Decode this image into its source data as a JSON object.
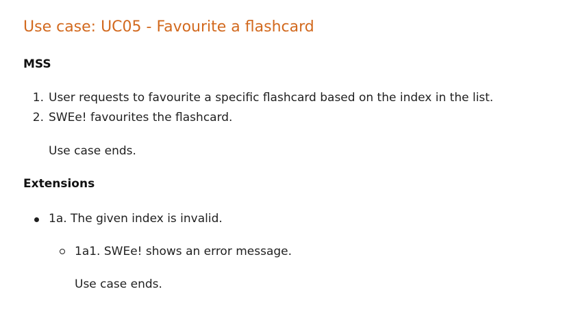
{
  "title": "Use case: UC05 - Favourite a flashcard",
  "mss": {
    "heading": "MSS",
    "steps": [
      {
        "number": "1.",
        "text": "User requests to favourite a specific flashcard based on the index in the list."
      },
      {
        "number": "2.",
        "text": "SWEe! favourites the flashcard."
      }
    ],
    "end": "Use case ends."
  },
  "extensions": {
    "heading": "Extensions",
    "items": [
      {
        "text": "1a. The given index is invalid.",
        "sub_items": [
          {
            "text": "1a1. SWEe! shows an error message."
          }
        ],
        "end": "Use case ends."
      }
    ]
  }
}
